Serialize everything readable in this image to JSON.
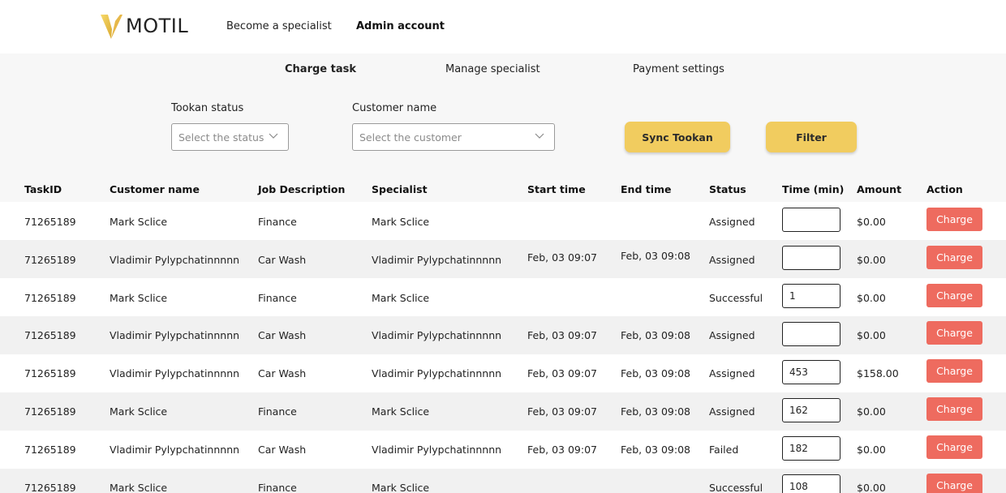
{
  "brand": {
    "name": "MOTIL",
    "accent": "#f1cc5f"
  },
  "topnav": {
    "links": [
      "Become a specialist",
      "Admin account"
    ]
  },
  "tabs": [
    "Charge task",
    "Manage specialist",
    "Payment settings"
  ],
  "filters": {
    "status_label": "Tookan status",
    "status_placeholder": "Select the status",
    "customer_label": "Customer name",
    "customer_placeholder": "Select the customer",
    "sync_button": "Sync Tookan",
    "filter_button": "Filter"
  },
  "table": {
    "columns": [
      "TaskID",
      "Customer name",
      "Job Description",
      "Specialist",
      "Start time",
      "End time",
      "Status",
      "Time (min)",
      "Amount",
      "Action"
    ],
    "rows": [
      {
        "task_id": "71265189",
        "customer": "Mark Sclice",
        "job": "Finance",
        "specialist": "Mark Sclice",
        "start": "",
        "end": "",
        "status": "Assigned",
        "time": "",
        "amount": "$0.00",
        "action": "Charge"
      },
      {
        "task_id": "71265189",
        "customer": "Vladimir Pylypchatinnnnn",
        "job": "Car Wash",
        "specialist": "Vladimir Pylypchatinnnnn",
        "start": "Feb, 03 09:07",
        "end": "Feb, 03 09:08",
        "status": "Assigned",
        "time": "",
        "amount": "$0.00",
        "action": "Charge"
      },
      {
        "task_id": "71265189",
        "customer": "Mark Sclice",
        "job": "Finance",
        "specialist": "Mark Sclice",
        "start": "",
        "end": "",
        "status": "Successful",
        "time": "1",
        "amount": "$0.00",
        "action": "Charge"
      },
      {
        "task_id": "71265189",
        "customer": "Vladimir Pylypchatinnnnn",
        "job": "Car Wash",
        "specialist": "Vladimir Pylypchatinnnnn",
        "start": "Feb, 03 09:07",
        "end": "Feb, 03 09:08",
        "status": "Assigned",
        "time": "",
        "amount": "$0.00",
        "action": "Charge"
      },
      {
        "task_id": "71265189",
        "customer": "Vladimir Pylypchatinnnnn",
        "job": "Car Wash",
        "specialist": "Vladimir Pylypchatinnnnn",
        "start": "Feb, 03 09:07",
        "end": "Feb, 03 09:08",
        "status": "Assigned",
        "time": "453",
        "amount": "$158.00",
        "action": "Charge"
      },
      {
        "task_id": "71265189",
        "customer": "Mark Sclice",
        "job": "Finance",
        "specialist": "Mark Sclice",
        "start": "Feb, 03 09:07",
        "end": "Feb, 03 09:08",
        "status": "Assigned",
        "time": "162",
        "amount": "$0.00",
        "action": "Charge"
      },
      {
        "task_id": "71265189",
        "customer": "Vladimir Pylypchatinnnnn",
        "job": "Car Wash",
        "specialist": "Vladimir Pylypchatinnnnn",
        "start": "Feb, 03 09:07",
        "end": "Feb, 03 09:08",
        "status": "Failed",
        "time": "182",
        "amount": "$0.00",
        "action": "Charge"
      },
      {
        "task_id": "71265189",
        "customer": "Mark Sclice",
        "job": "Finance",
        "specialist": "Mark Sclice",
        "start": "",
        "end": "",
        "status": "Successful",
        "time": "108",
        "amount": "$0.00",
        "action": "Charge"
      }
    ]
  },
  "colors": {
    "charge_button": "#ee6b5f",
    "accent_yellow": "#f1cc5f",
    "row_stripe": "#f1f1f1"
  }
}
